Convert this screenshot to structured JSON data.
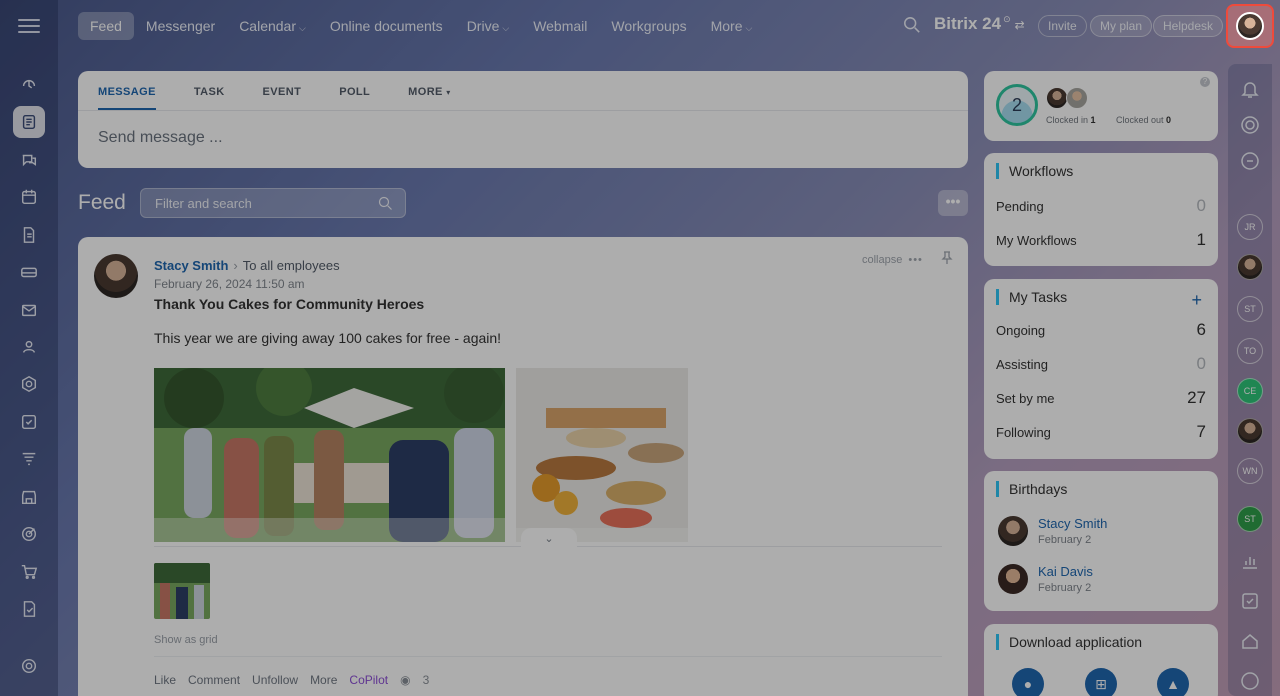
{
  "nav": {
    "items": [
      {
        "label": "Feed",
        "active": true
      },
      {
        "label": "Messenger",
        "chevron": false
      },
      {
        "label": "Calendar",
        "chevron": true
      },
      {
        "label": "Online documents",
        "chevron": false
      },
      {
        "label": "Drive",
        "chevron": true
      },
      {
        "label": "Webmail",
        "chevron": false
      },
      {
        "label": "Workgroups",
        "chevron": false
      },
      {
        "label": "More",
        "chevron": true
      }
    ],
    "brand": "Bitrix 24",
    "brand_mark": "⊙",
    "invite": "Invite",
    "my_plan": "My plan",
    "helpdesk": "Helpdesk"
  },
  "composer": {
    "tabs": [
      "MESSAGE",
      "TASK",
      "EVENT",
      "POLL",
      "MORE"
    ],
    "placeholder": "Send message ..."
  },
  "feed": {
    "title": "Feed",
    "filter_placeholder": "Filter and search",
    "menu": "•••"
  },
  "post": {
    "author": "Stacy Smith",
    "recipients": "To all employees",
    "date": "February 26, 2024 11:50 am",
    "title": "Thank You Cakes for Community Heroes",
    "body": "This year we are giving away 100 cakes for free - again!",
    "collapse": "collapse",
    "collapse_more": "•••",
    "show_as_grid": "Show as grid",
    "actions": {
      "like": "Like",
      "comment": "Comment",
      "unfollow": "Unfollow",
      "more": "More",
      "copilot": "CoPilot",
      "views": "3"
    }
  },
  "timeman": {
    "count": "2",
    "clocked_in_label": "Clocked in",
    "clocked_in": "1",
    "clocked_out_label": "Clocked out",
    "clocked_out": "0"
  },
  "workflows": {
    "title": "Workflows",
    "rows": [
      {
        "label": "Pending",
        "value": "0"
      },
      {
        "label": "My Workflows",
        "value": "1"
      }
    ]
  },
  "tasks": {
    "title": "My Tasks",
    "plus": "+",
    "rows": [
      {
        "label": "Ongoing",
        "value": "6"
      },
      {
        "label": "Assisting",
        "value": "0"
      },
      {
        "label": "Set by me",
        "value": "27"
      },
      {
        "label": "Following",
        "value": "7"
      }
    ]
  },
  "birthdays": {
    "title": "Birthdays",
    "people": [
      {
        "name": "Stacy Smith",
        "date": "February 2"
      },
      {
        "name": "Kai Davis",
        "date": "February 2"
      }
    ]
  },
  "download": {
    "title": "Download application"
  },
  "right_bar": {
    "avatars": [
      "JR",
      "",
      "ST",
      "TO",
      "CE",
      "",
      "WN",
      "ST"
    ]
  },
  "colors": {
    "accent": "#2067b0",
    "highlight": "#ee4b3c",
    "copilot": "#8d4fd6",
    "widget_bar": "#2fc6f6"
  }
}
